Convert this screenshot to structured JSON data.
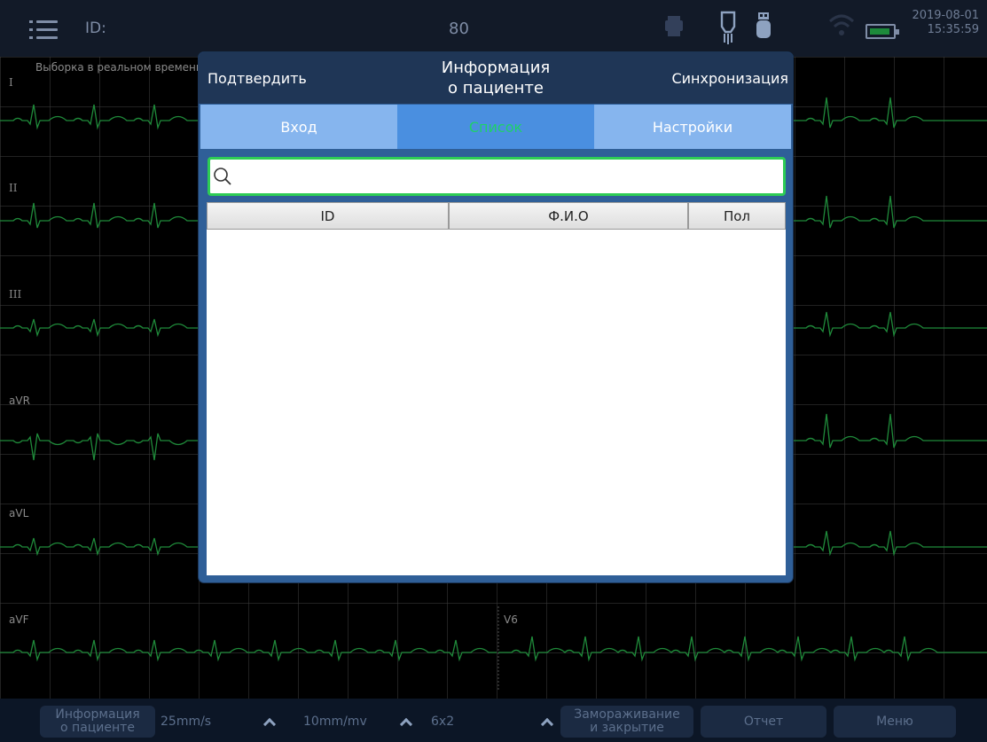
{
  "status_bar": {
    "id_label": "ID:",
    "heart_rate": "80",
    "date": "2019-08-01",
    "time": "15:35:59",
    "icons": [
      "printer-icon",
      "lead-connector-icon",
      "usb-drive-icon",
      "wifi-icon",
      "battery-icon"
    ]
  },
  "ecg": {
    "realtime_label": "Выборка в реальном времени",
    "leads": [
      "I",
      "II",
      "III",
      "aVR",
      "aVL",
      "aVF",
      "V6"
    ]
  },
  "modal": {
    "confirm_label": "Подтвердить",
    "title_line1": "Информация",
    "title_line2": "о пациенте",
    "sync_label": "Синхронизация",
    "tabs": [
      {
        "label": "Вход",
        "active": false
      },
      {
        "label": "Список",
        "active": true
      },
      {
        "label": "Настройки",
        "active": false
      }
    ],
    "search": {
      "value": "",
      "placeholder": ""
    },
    "table": {
      "columns": [
        "ID",
        "Ф.И.О",
        "Пол"
      ],
      "rows": []
    }
  },
  "bottom_bar": {
    "patient_info_line1": "Информация",
    "patient_info_line2": "о пациенте",
    "speed": "25mm/s",
    "gain": "10mm/mv",
    "layout": "6x2",
    "freeze_line1": "Замораживание",
    "freeze_line2": "и закрытие",
    "report": "Отчет",
    "menu": "Меню"
  },
  "colors": {
    "accent": "#2f5f98",
    "active_tab_text": "#1fd06a",
    "ecg_trace": "#1f8a3a",
    "search_border": "#2ecc55"
  }
}
